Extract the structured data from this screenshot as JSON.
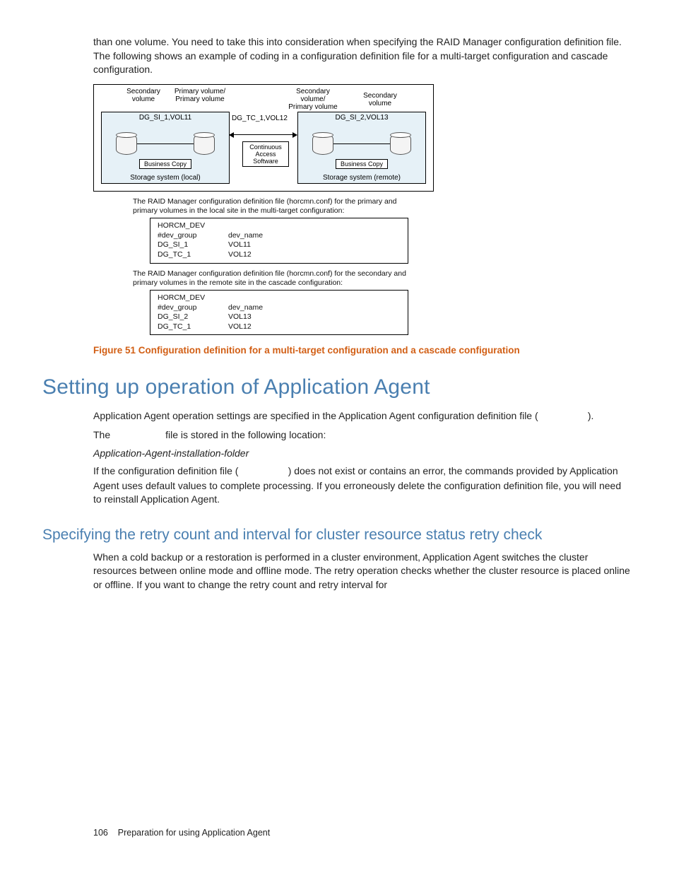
{
  "intro_para": "than one volume. You need to take this into consideration when specifying the RAID Manager configuration definition file. The following shows an example of coding in a configuration definition file for a multi-target configuration and cascade configuration.",
  "diagram": {
    "top_labels": {
      "sec_vol_l": "Secondary\nvolume",
      "pri_pri_l": "Primary volume/\nPrimary volume",
      "pri_pri_r": "Secondary volume/\nPrimary volume",
      "sec_vol_r": "Secondary volume"
    },
    "left_box": {
      "header": "DG_SI_1,VOL11",
      "label": "Business Copy",
      "footer": "Storage system (local)"
    },
    "center_top": "DG_TC_1,VOL12",
    "center_box": "Continuous\nAccess\nSoftware",
    "right_box": {
      "header": "DG_SI_2,VOL13",
      "label": "Business Copy",
      "footer": "Storage system (remote)"
    }
  },
  "desc1": "The RAID Manager configuration definition file (horcmn.conf) for the primary and primary volumes in the local site in the multi-target configuration:",
  "block1": {
    "r0": "HORCM_DEV",
    "r1c1": "#dev_group",
    "r1c2": "dev_name",
    "r2c1": "DG_SI_1",
    "r2c2": "VOL11",
    "r3c1": "DG_TC_1",
    "r3c2": "VOL12"
  },
  "desc2": "The RAID Manager configuration definition file (horcmn.conf) for the secondary and primary volumes in the remote site in the cascade configuration:",
  "block2": {
    "r0": "HORCM_DEV",
    "r1c1": "#dev_group",
    "r1c2": "dev_name",
    "r2c1": "DG_SI_2",
    "r2c2": "VOL13",
    "r3c1": "DG_TC_1",
    "r3c2": "VOL12"
  },
  "figure_caption": "Figure 51 Configuration definition for a multi-target configuration and a cascade configuration",
  "h1": "Setting up operation of Application Agent",
  "p1_a": "Application Agent operation settings are specified in the Application Agent configuration definition file (",
  "p1_b": ").",
  "p2_a": "The ",
  "p2_b": " file is stored in the following location:",
  "path_italic": "Application-Agent-installation-folder",
  "p3_a": "If the configuration definition file (",
  "p3_b": ") does not exist or contains an error, the commands provided by Application Agent uses default values to complete processing. If you erroneously delete the configuration definition file, you will need to reinstall Application Agent.",
  "h2": "Specifying the retry count and interval for cluster resource status retry check",
  "p4": "When a cold backup or a restoration is performed in a cluster environment, Application Agent switches the cluster resources between online mode and offline mode. The retry operation checks whether the cluster resource is placed online or offline. If you want to change the retry count and retry interval for",
  "footer_page": "106",
  "footer_text": "Preparation for using Application Agent"
}
